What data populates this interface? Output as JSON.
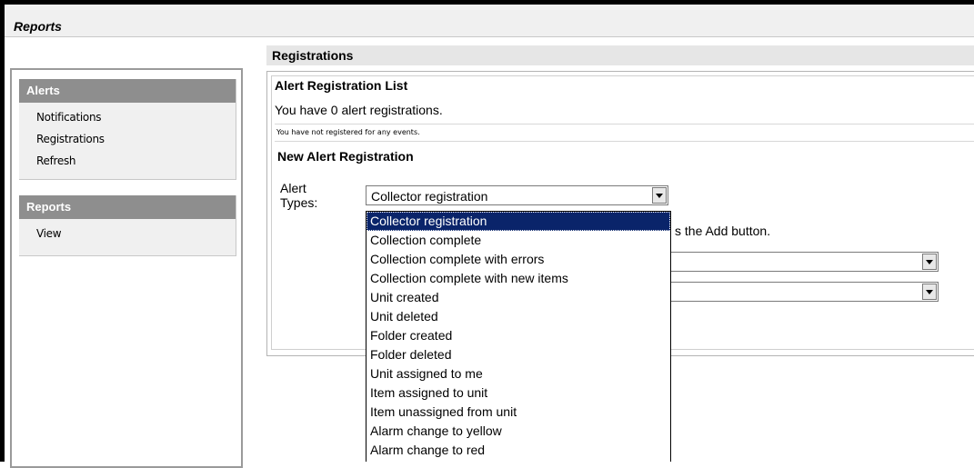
{
  "window": {
    "title": "Reports"
  },
  "sidebar": {
    "alerts": {
      "heading": "Alerts",
      "items": [
        "Notifications",
        "Registrations",
        "Refresh"
      ]
    },
    "reports": {
      "heading": "Reports",
      "items": [
        "View"
      ]
    }
  },
  "main": {
    "section_title": "Registrations",
    "list_heading": "Alert Registration List",
    "count_text": "You have 0 alert registrations.",
    "empty_note": "You have not registered for any events.",
    "new_heading": "New Alert Registration",
    "alert_label_line1": "Alert",
    "alert_label_line2": "Types:",
    "selected_type": "Collector registration",
    "hint_tail": "s the Add button.",
    "alert_type_options": [
      "Collector registration",
      "Collection complete",
      "Collection complete with errors",
      "Collection complete with new items",
      "Unit created",
      "Unit deleted",
      "Folder created",
      "Folder deleted",
      "Unit assigned to me",
      "Item assigned to unit",
      "Item unassigned from unit",
      "Alarm change to yellow",
      "Alarm change to red"
    ],
    "highlighted_option_index": 0
  },
  "colors": {
    "selection": "#0a246a",
    "sidebar_header": "#8e8e8e"
  }
}
